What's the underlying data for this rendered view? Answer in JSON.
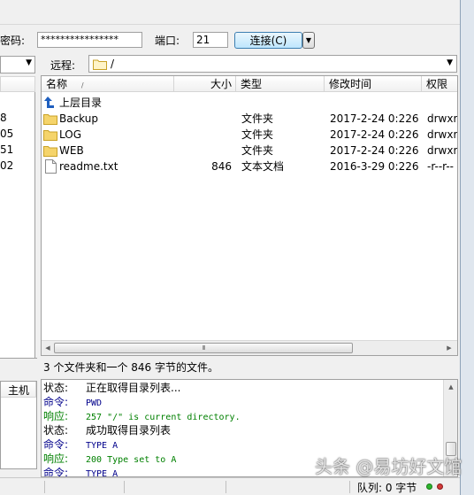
{
  "connect_bar": {
    "password_label": "密码:",
    "password_value": "****************",
    "port_label": "端口:",
    "port_value": "21",
    "connect_label": "连接(C)"
  },
  "remote": {
    "label": "远程:",
    "path": "/",
    "columns": [
      "名称",
      "大小",
      "类型",
      "修改时间",
      "权限"
    ],
    "sort_indicator": "/",
    "up_label": "上层目录",
    "files": [
      {
        "name": "Backup",
        "size": "",
        "type": "文件夹",
        "modified": "2017-2-24 0:226",
        "perm": "drwxr",
        "icon": "folder-icon"
      },
      {
        "name": "LOG",
        "size": "",
        "type": "文件夹",
        "modified": "2017-2-24 0:226",
        "perm": "drwxr",
        "icon": "folder-icon"
      },
      {
        "name": "WEB",
        "size": "",
        "type": "文件夹",
        "modified": "2017-2-24 0:226",
        "perm": "drwxr",
        "icon": "folder-icon"
      },
      {
        "name": "readme.txt",
        "size": "846",
        "type": "文本文档",
        "modified": "2016-3-29 0:226",
        "perm": "-r--r--",
        "icon": "text-file-icon"
      }
    ],
    "status_text": "3 个文件夹和一个 846 字节的文件。",
    "scroll_grip": "III"
  },
  "local": {
    "partial_rows": [
      "8",
      "05",
      "51",
      "02"
    ],
    "host_tab": "主机"
  },
  "log": {
    "lines": [
      {
        "label": "状态:",
        "text": "正在取得目录列表...",
        "kind": "status"
      },
      {
        "label": "命令:",
        "text": "PWD",
        "kind": "command"
      },
      {
        "label": "响应:",
        "text": "257 \"/\" is current directory.",
        "kind": "response"
      },
      {
        "label": "状态:",
        "text": "成功取得目录列表",
        "kind": "status"
      },
      {
        "label": "命令:",
        "text": "TYPE A",
        "kind": "command"
      },
      {
        "label": "响应:",
        "text": "200 Type set to A",
        "kind": "response"
      },
      {
        "label": "命令:",
        "text": "TYPE A",
        "kind": "command"
      }
    ]
  },
  "statusbar": {
    "queue_text": "队列: 0 字节"
  },
  "watermark": {
    "text": "头条 @易坊好文馆"
  },
  "colors": {
    "command": "#00008b",
    "response": "#008000",
    "folder": "#f5c842",
    "accent": "#3399ff"
  }
}
